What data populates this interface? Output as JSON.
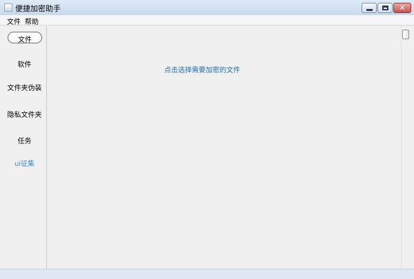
{
  "window": {
    "title": "便捷加密助手"
  },
  "menu": {
    "file": "文件",
    "help": "帮助"
  },
  "sidebar": {
    "items": [
      {
        "label": "文件",
        "selected": true
      },
      {
        "label": "软件"
      },
      {
        "label": "文件夹伪装"
      },
      {
        "label": "隐私文件夹"
      },
      {
        "label": "任务"
      },
      {
        "label": "ui征集",
        "accent": true
      }
    ]
  },
  "content": {
    "hint": "点击选择需要加密的文件"
  },
  "colors": {
    "accent": "#3a8ec9",
    "hint": "#1f6fb2"
  }
}
